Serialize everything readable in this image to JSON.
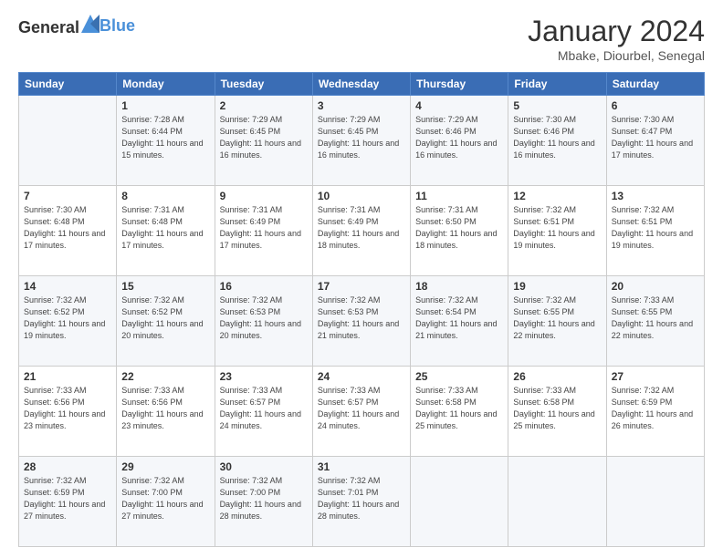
{
  "header": {
    "logo_general": "General",
    "logo_blue": "Blue",
    "title": "January 2024",
    "location": "Mbake, Diourbel, Senegal"
  },
  "columns": [
    "Sunday",
    "Monday",
    "Tuesday",
    "Wednesday",
    "Thursday",
    "Friday",
    "Saturday"
  ],
  "rows": [
    [
      {
        "day": "",
        "sunrise": "",
        "sunset": "",
        "daylight": ""
      },
      {
        "day": "1",
        "sunrise": "Sunrise: 7:28 AM",
        "sunset": "Sunset: 6:44 PM",
        "daylight": "Daylight: 11 hours and 15 minutes."
      },
      {
        "day": "2",
        "sunrise": "Sunrise: 7:29 AM",
        "sunset": "Sunset: 6:45 PM",
        "daylight": "Daylight: 11 hours and 16 minutes."
      },
      {
        "day": "3",
        "sunrise": "Sunrise: 7:29 AM",
        "sunset": "Sunset: 6:45 PM",
        "daylight": "Daylight: 11 hours and 16 minutes."
      },
      {
        "day": "4",
        "sunrise": "Sunrise: 7:29 AM",
        "sunset": "Sunset: 6:46 PM",
        "daylight": "Daylight: 11 hours and 16 minutes."
      },
      {
        "day": "5",
        "sunrise": "Sunrise: 7:30 AM",
        "sunset": "Sunset: 6:46 PM",
        "daylight": "Daylight: 11 hours and 16 minutes."
      },
      {
        "day": "6",
        "sunrise": "Sunrise: 7:30 AM",
        "sunset": "Sunset: 6:47 PM",
        "daylight": "Daylight: 11 hours and 17 minutes."
      }
    ],
    [
      {
        "day": "7",
        "sunrise": "Sunrise: 7:30 AM",
        "sunset": "Sunset: 6:48 PM",
        "daylight": "Daylight: 11 hours and 17 minutes."
      },
      {
        "day": "8",
        "sunrise": "Sunrise: 7:31 AM",
        "sunset": "Sunset: 6:48 PM",
        "daylight": "Daylight: 11 hours and 17 minutes."
      },
      {
        "day": "9",
        "sunrise": "Sunrise: 7:31 AM",
        "sunset": "Sunset: 6:49 PM",
        "daylight": "Daylight: 11 hours and 17 minutes."
      },
      {
        "day": "10",
        "sunrise": "Sunrise: 7:31 AM",
        "sunset": "Sunset: 6:49 PM",
        "daylight": "Daylight: 11 hours and 18 minutes."
      },
      {
        "day": "11",
        "sunrise": "Sunrise: 7:31 AM",
        "sunset": "Sunset: 6:50 PM",
        "daylight": "Daylight: 11 hours and 18 minutes."
      },
      {
        "day": "12",
        "sunrise": "Sunrise: 7:32 AM",
        "sunset": "Sunset: 6:51 PM",
        "daylight": "Daylight: 11 hours and 19 minutes."
      },
      {
        "day": "13",
        "sunrise": "Sunrise: 7:32 AM",
        "sunset": "Sunset: 6:51 PM",
        "daylight": "Daylight: 11 hours and 19 minutes."
      }
    ],
    [
      {
        "day": "14",
        "sunrise": "Sunrise: 7:32 AM",
        "sunset": "Sunset: 6:52 PM",
        "daylight": "Daylight: 11 hours and 19 minutes."
      },
      {
        "day": "15",
        "sunrise": "Sunrise: 7:32 AM",
        "sunset": "Sunset: 6:52 PM",
        "daylight": "Daylight: 11 hours and 20 minutes."
      },
      {
        "day": "16",
        "sunrise": "Sunrise: 7:32 AM",
        "sunset": "Sunset: 6:53 PM",
        "daylight": "Daylight: 11 hours and 20 minutes."
      },
      {
        "day": "17",
        "sunrise": "Sunrise: 7:32 AM",
        "sunset": "Sunset: 6:53 PM",
        "daylight": "Daylight: 11 hours and 21 minutes."
      },
      {
        "day": "18",
        "sunrise": "Sunrise: 7:32 AM",
        "sunset": "Sunset: 6:54 PM",
        "daylight": "Daylight: 11 hours and 21 minutes."
      },
      {
        "day": "19",
        "sunrise": "Sunrise: 7:32 AM",
        "sunset": "Sunset: 6:55 PM",
        "daylight": "Daylight: 11 hours and 22 minutes."
      },
      {
        "day": "20",
        "sunrise": "Sunrise: 7:33 AM",
        "sunset": "Sunset: 6:55 PM",
        "daylight": "Daylight: 11 hours and 22 minutes."
      }
    ],
    [
      {
        "day": "21",
        "sunrise": "Sunrise: 7:33 AM",
        "sunset": "Sunset: 6:56 PM",
        "daylight": "Daylight: 11 hours and 23 minutes."
      },
      {
        "day": "22",
        "sunrise": "Sunrise: 7:33 AM",
        "sunset": "Sunset: 6:56 PM",
        "daylight": "Daylight: 11 hours and 23 minutes."
      },
      {
        "day": "23",
        "sunrise": "Sunrise: 7:33 AM",
        "sunset": "Sunset: 6:57 PM",
        "daylight": "Daylight: 11 hours and 24 minutes."
      },
      {
        "day": "24",
        "sunrise": "Sunrise: 7:33 AM",
        "sunset": "Sunset: 6:57 PM",
        "daylight": "Daylight: 11 hours and 24 minutes."
      },
      {
        "day": "25",
        "sunrise": "Sunrise: 7:33 AM",
        "sunset": "Sunset: 6:58 PM",
        "daylight": "Daylight: 11 hours and 25 minutes."
      },
      {
        "day": "26",
        "sunrise": "Sunrise: 7:33 AM",
        "sunset": "Sunset: 6:58 PM",
        "daylight": "Daylight: 11 hours and 25 minutes."
      },
      {
        "day": "27",
        "sunrise": "Sunrise: 7:32 AM",
        "sunset": "Sunset: 6:59 PM",
        "daylight": "Daylight: 11 hours and 26 minutes."
      }
    ],
    [
      {
        "day": "28",
        "sunrise": "Sunrise: 7:32 AM",
        "sunset": "Sunset: 6:59 PM",
        "daylight": "Daylight: 11 hours and 27 minutes."
      },
      {
        "day": "29",
        "sunrise": "Sunrise: 7:32 AM",
        "sunset": "Sunset: 7:00 PM",
        "daylight": "Daylight: 11 hours and 27 minutes."
      },
      {
        "day": "30",
        "sunrise": "Sunrise: 7:32 AM",
        "sunset": "Sunset: 7:00 PM",
        "daylight": "Daylight: 11 hours and 28 minutes."
      },
      {
        "day": "31",
        "sunrise": "Sunrise: 7:32 AM",
        "sunset": "Sunset: 7:01 PM",
        "daylight": "Daylight: 11 hours and 28 minutes."
      },
      {
        "day": "",
        "sunrise": "",
        "sunset": "",
        "daylight": ""
      },
      {
        "day": "",
        "sunrise": "",
        "sunset": "",
        "daylight": ""
      },
      {
        "day": "",
        "sunrise": "",
        "sunset": "",
        "daylight": ""
      }
    ]
  ]
}
